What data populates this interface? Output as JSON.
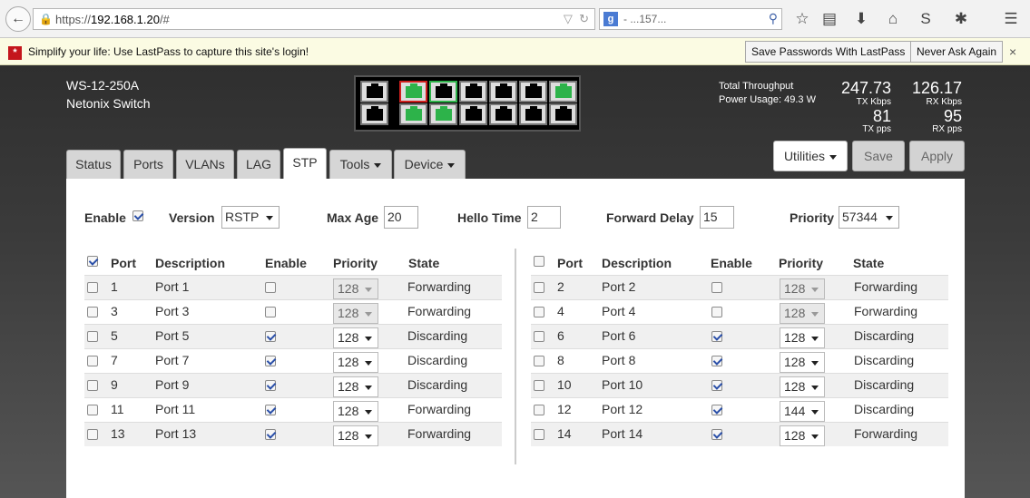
{
  "browser": {
    "url_prefix": "https://",
    "url_host": "192.168.1.20",
    "url_path": "/#",
    "search_text": "- ...157..."
  },
  "lastpass": {
    "message": "Simplify your life: Use LastPass to capture this site's login!",
    "save_button": "Save Passwords With LastPass",
    "never_button": "Never Ask Again",
    "close": "×"
  },
  "device": {
    "model": "WS-12-250A",
    "name": "Netonix Switch"
  },
  "ports_panel": {
    "top": [
      {
        "color": "black",
        "status": "down"
      },
      {
        "color": "green",
        "status": "up",
        "selected": true
      },
      {
        "color": "black",
        "status": "down",
        "green_border": true
      },
      {
        "color": "black",
        "status": "down"
      },
      {
        "color": "black",
        "status": "down"
      },
      {
        "color": "black",
        "status": "down"
      },
      {
        "color": "green",
        "status": "up"
      }
    ],
    "bottom": [
      {
        "color": "black",
        "status": "down"
      },
      {
        "color": "green",
        "status": "up"
      },
      {
        "color": "green",
        "status": "up"
      },
      {
        "color": "black",
        "status": "down"
      },
      {
        "color": "black",
        "status": "down"
      },
      {
        "color": "black",
        "status": "down"
      },
      {
        "color": "black",
        "status": "down"
      }
    ]
  },
  "throughput": {
    "title": "Total Throughput",
    "power": "Power Usage: 49.3 W",
    "tx_kbps": "247.73",
    "tx_kbps_unit": "TX Kbps",
    "rx_kbps": "126.17",
    "rx_kbps_unit": "RX Kbps",
    "tx_pps": "81",
    "tx_pps_unit": "TX pps",
    "rx_pps": "95",
    "rx_pps_unit": "RX pps"
  },
  "tabs": [
    {
      "label": "Status"
    },
    {
      "label": "Ports"
    },
    {
      "label": "VLANs"
    },
    {
      "label": "LAG"
    },
    {
      "label": "STP",
      "active": true
    },
    {
      "label": "Tools"
    },
    {
      "label": "Device"
    }
  ],
  "actions": {
    "utilities": "Utilities",
    "save": "Save",
    "apply": "Apply"
  },
  "stp": {
    "enable_label": "Enable",
    "enable_checked": true,
    "version_label": "Version",
    "version": "RSTP",
    "max_age_label": "Max Age",
    "max_age": "20",
    "hello_label": "Hello Time",
    "hello": "2",
    "fwd_label": "Forward Delay",
    "fwd": "15",
    "priority_label": "Priority",
    "priority": "57344"
  },
  "table_headers": {
    "port": "Port",
    "description": "Description",
    "enable": "Enable",
    "priority": "Priority",
    "state": "State"
  },
  "left_ports": [
    {
      "port": "1",
      "desc": "Port 1",
      "enabled": false,
      "priority": "128",
      "disabled": true,
      "state": "Forwarding"
    },
    {
      "port": "3",
      "desc": "Port 3",
      "enabled": false,
      "priority": "128",
      "disabled": true,
      "state": "Forwarding"
    },
    {
      "port": "5",
      "desc": "Port 5",
      "enabled": true,
      "priority": "128",
      "disabled": false,
      "state": "Discarding"
    },
    {
      "port": "7",
      "desc": "Port 7",
      "enabled": true,
      "priority": "128",
      "disabled": false,
      "state": "Discarding"
    },
    {
      "port": "9",
      "desc": "Port 9",
      "enabled": true,
      "priority": "128",
      "disabled": false,
      "state": "Discarding"
    },
    {
      "port": "11",
      "desc": "Port 11",
      "enabled": true,
      "priority": "128",
      "disabled": false,
      "state": "Forwarding"
    },
    {
      "port": "13",
      "desc": "Port 13",
      "enabled": true,
      "priority": "128",
      "disabled": false,
      "state": "Forwarding"
    }
  ],
  "right_ports": [
    {
      "port": "2",
      "desc": "Port 2",
      "enabled": false,
      "priority": "128",
      "disabled": true,
      "state": "Forwarding"
    },
    {
      "port": "4",
      "desc": "Port 4",
      "enabled": false,
      "priority": "128",
      "disabled": true,
      "state": "Forwarding"
    },
    {
      "port": "6",
      "desc": "Port 6",
      "enabled": true,
      "priority": "128",
      "disabled": false,
      "state": "Discarding"
    },
    {
      "port": "8",
      "desc": "Port 8",
      "enabled": true,
      "priority": "128",
      "disabled": false,
      "state": "Discarding"
    },
    {
      "port": "10",
      "desc": "Port 10",
      "enabled": true,
      "priority": "128",
      "disabled": false,
      "state": "Discarding"
    },
    {
      "port": "12",
      "desc": "Port 12",
      "enabled": true,
      "priority": "144",
      "disabled": false,
      "state": "Discarding"
    },
    {
      "port": "14",
      "desc": "Port 14",
      "enabled": true,
      "priority": "128",
      "disabled": false,
      "state": "Forwarding"
    }
  ],
  "colors": {
    "port_up": "#2db34a",
    "port_down": "#000000",
    "port_selected_border": "#d0201e"
  }
}
